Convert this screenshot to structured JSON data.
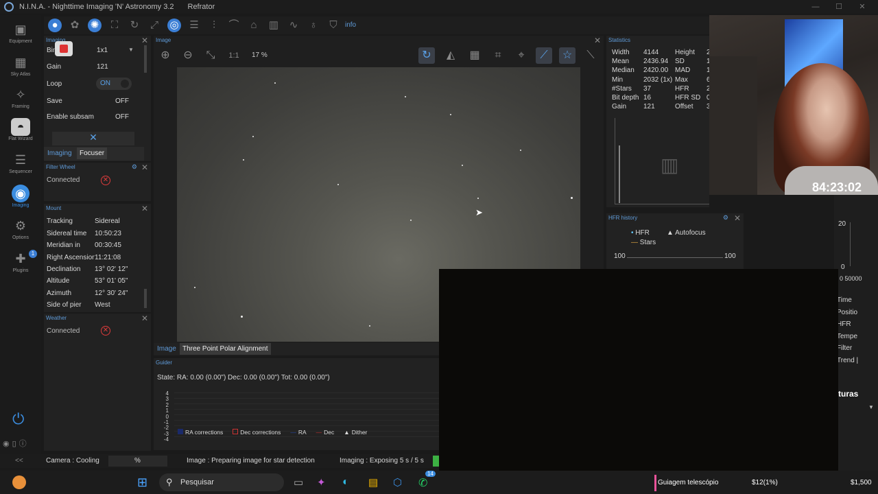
{
  "window": {
    "app_title": "N.I.N.A. - Nighttime Imaging 'N' Astronomy 3.2",
    "profile": "Refrator"
  },
  "leftnav": [
    {
      "label": "Equipment"
    },
    {
      "label": "Sky Atlas"
    },
    {
      "label": "Framing"
    },
    {
      "label": "Flat Wizard"
    },
    {
      "label": "Sequencer"
    },
    {
      "label": "Imaging"
    },
    {
      "label": "Options"
    },
    {
      "label": "Plugins",
      "badge": "1"
    }
  ],
  "toolbar": {
    "info_label": "info"
  },
  "imaging_panel": {
    "title": "Imaging",
    "bin_label": "Bin",
    "bin_value": "1x1",
    "gain_label": "Gain",
    "gain_value": "121",
    "loop_label": "Loop",
    "loop_value": "ON",
    "save_label": "Save",
    "save_value": "OFF",
    "subsam_label": "Enable subsam",
    "subsam_value": "OFF",
    "tab_imaging": "Imaging",
    "tab_focuser": "Focuser"
  },
  "filter_wheel": {
    "title": "Filter Wheel",
    "connected_label": "Connected"
  },
  "mount": {
    "title": "Mount",
    "rows": [
      {
        "label": "Tracking",
        "value": "Sidereal"
      },
      {
        "label": "Sidereal time",
        "value": "10:50:23"
      },
      {
        "label": "Meridian in",
        "value": "00:30:45"
      },
      {
        "label": "Right Ascension",
        "value": "11:21:08"
      },
      {
        "label": "Declination",
        "value": "13° 02' 12\""
      },
      {
        "label": "Altitude",
        "value": "53° 01' 05\""
      },
      {
        "label": "Azimuth",
        "value": "12° 30' 24\""
      },
      {
        "label": "Side of pier",
        "value": "West"
      }
    ]
  },
  "weather": {
    "title": "Weather",
    "connected_label": "Connected"
  },
  "image_panel": {
    "title": "Image",
    "one_to_one": "1:1",
    "zoom": "17 %",
    "tab_image": "Image",
    "tab_tppa": "Three Point Polar Alignment"
  },
  "statistics": {
    "title": "Statistics",
    "left": [
      {
        "label": "Width",
        "value": "4144"
      },
      {
        "label": "Mean",
        "value": "2436.94"
      },
      {
        "label": "Median",
        "value": "2420.00"
      },
      {
        "label": "Min",
        "value": "2032 (1x)"
      },
      {
        "label": "#Stars",
        "value": "37"
      },
      {
        "label": "Bit depth",
        "value": "16"
      },
      {
        "label": "Gain",
        "value": "121"
      }
    ],
    "right": [
      {
        "label": "Height",
        "value": "2"
      },
      {
        "label": "SD",
        "value": "1"
      },
      {
        "label": "MAD",
        "value": "1"
      },
      {
        "label": "Max",
        "value": "6"
      },
      {
        "label": "HFR",
        "value": "2"
      },
      {
        "label": "HFR SD",
        "value": "0"
      },
      {
        "label": "Offset",
        "value": "3"
      }
    ]
  },
  "hfr_history": {
    "title": "HFR history",
    "legend_hfr": "HFR",
    "legend_af": "Autofocus",
    "legend_stars": "Stars",
    "axis_left": "100",
    "axis_right": "100"
  },
  "right_strip": {
    "y20": "20",
    "y0": "0",
    "x_ticks": "0 50000",
    "items": [
      "Time",
      "Positio",
      "HFR",
      "Tempe",
      "Filter",
      "Trend  |"
    ],
    "turas": "turas"
  },
  "guider": {
    "title": "Guider",
    "state": "State:  RA: 0.00 (0.00\")  Dec: 0.00 (0.00\")  Tot: 0.00 (0.00\")",
    "y_ticks": [
      "4",
      "3",
      "2",
      "1",
      "0",
      "-1",
      "-2",
      "-3",
      "-4"
    ],
    "legend": [
      "RA corrections",
      "Dec corrections",
      "RA",
      "Dec",
      "Dither"
    ]
  },
  "statusbar": {
    "collapse": "<<",
    "camera": "Camera :  Cooling",
    "percent": "%",
    "image": "Image :  Preparing image for star detection",
    "imaging": "Imaging :  Exposing 5 s / 5 s"
  },
  "webcam": {
    "timer": "84:23:02"
  },
  "taskbar": {
    "search_placeholder": "Pesquisar",
    "badge": "14",
    "goal_label": "Guiagem telescópio",
    "goal_progress": "$12(1%)",
    "goal_total": "$1,500"
  },
  "colors": {
    "accent": "#3b8de0",
    "error": "#e03c3c"
  }
}
